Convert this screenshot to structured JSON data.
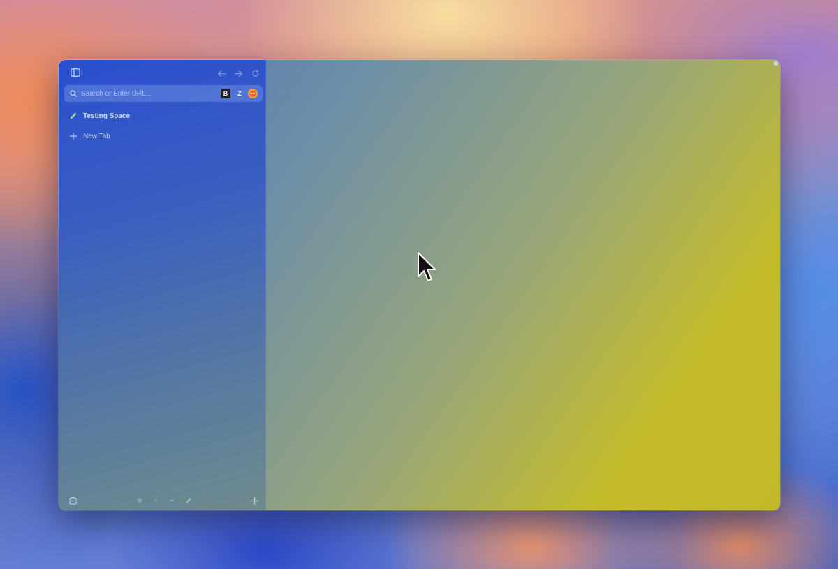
{
  "sidebar": {
    "search": {
      "placeholder": "Search or Enter URL..."
    },
    "extensions": [
      "B",
      "Z",
      ""
    ],
    "space": {
      "label": "Testing Space"
    },
    "new_tab": {
      "label": "New Tab"
    },
    "icons": {
      "toggle": "sidebar-toggle-icon",
      "back": "arrow-left-icon",
      "forward": "arrow-right-icon",
      "reload": "reload-icon",
      "archive": "archive-icon",
      "add": "plus-icon"
    }
  },
  "colors": {
    "sidebar_top": "#2a4fcf",
    "content_right": "#c4bc2a"
  }
}
